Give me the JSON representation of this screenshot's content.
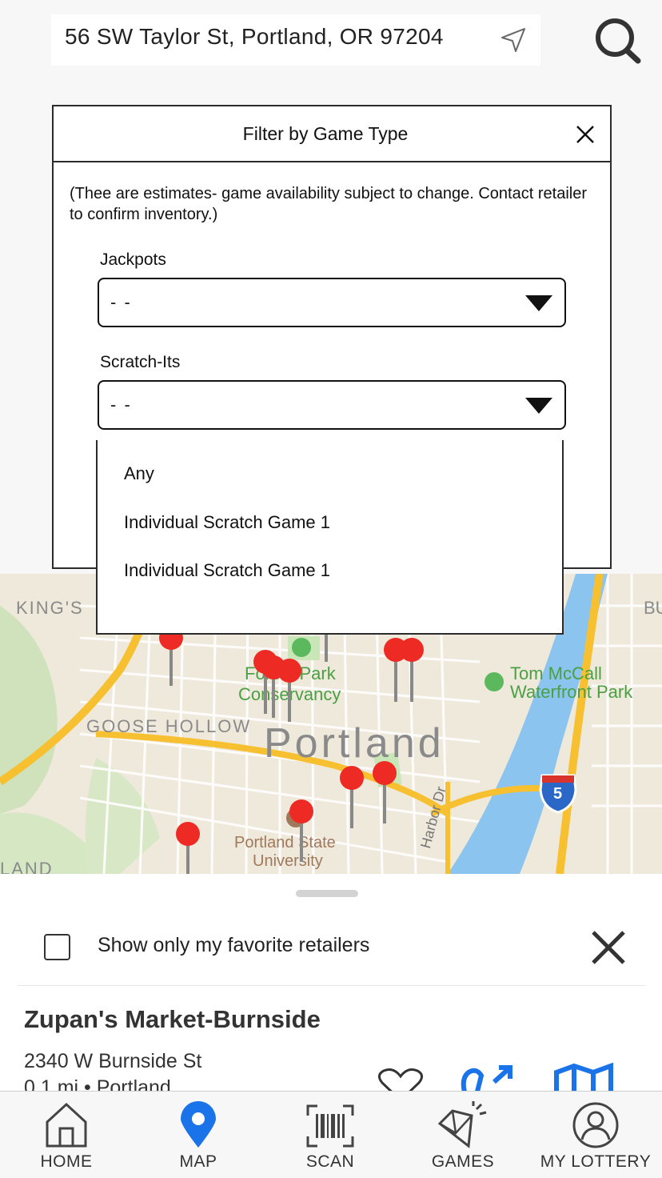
{
  "search": {
    "address": "56 SW Taylor St, Portland, OR 97204",
    "location_icon": "navigation-arrow-icon",
    "search_icon": "search-icon"
  },
  "modal": {
    "title": "Filter by Game Type",
    "note": "(Thee are estimates- game availability subject to change. Contact retailer to confirm inventory.)",
    "jackpots": {
      "label": "Jackpots",
      "value": "- -"
    },
    "scratch_its": {
      "label": "Scratch-Its",
      "value": "- -"
    }
  },
  "dropdown": {
    "options": [
      "Any",
      "Individual Scratch Game 1",
      "Individual Scratch Game 1"
    ]
  },
  "map": {
    "labels": {
      "kings": "KING'S",
      "bu": "BU",
      "goose_hollow": "GOOSE HOLLOW",
      "portland": "Portland",
      "forest_park_1": "Forest Park",
      "forest_park_2": "Conservancy",
      "tom_mccall_1": "Tom McCall",
      "tom_mccall_2": "Waterfront Park",
      "psu_1": "Portland State",
      "psu_2": "University",
      "harbor_dr": "Harbor Dr",
      "land": "LAND",
      "shield_5": "5"
    }
  },
  "sheet": {
    "favorites_label": "Show only my favorite retailers",
    "favorites_checked": false,
    "retailer": {
      "name": "Zupan's Market-Burnside",
      "address": "2340 W Burnside St",
      "distance": "0.1 mi • Portland"
    }
  },
  "nav": {
    "items": [
      {
        "label": "HOME",
        "icon": "home-icon"
      },
      {
        "label": "MAP",
        "icon": "map-pin-icon",
        "active": true
      },
      {
        "label": "SCAN",
        "icon": "barcode-icon"
      },
      {
        "label": "GAMES",
        "icon": "diamond-icon"
      },
      {
        "label": "MY LOTTERY",
        "icon": "user-icon"
      }
    ],
    "active_color": "#1a73e8"
  },
  "colors": {
    "accent": "#1a73e8",
    "pin": "#ee2a24",
    "water": "#8cc4f0",
    "park": "#c9e6b8",
    "highway": "#f7c030"
  }
}
